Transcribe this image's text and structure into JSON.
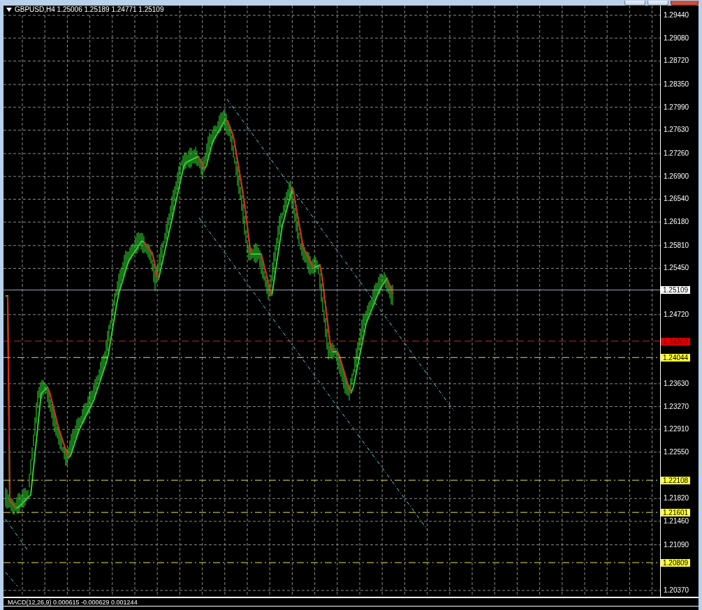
{
  "chart": {
    "header": "GBPUSD,H4  1.25006 1.25189 1.24771 1.25109",
    "axis_labels": [
      "1.29440",
      "1.29080",
      "1.28720",
      "1.28350",
      "1.27990",
      "1.27630",
      "1.27260",
      "1.26900",
      "1.26540",
      "1.26180",
      "1.25810",
      "1.25450",
      "1.24720",
      "1.23630",
      "1.23270",
      "1.22910",
      "1.22550",
      "1.21820",
      "1.21460",
      "1.21090",
      "1.20370"
    ],
    "levels": [
      {
        "label": "1.25109",
        "kind": "bid"
      },
      {
        "label": "1.24302",
        "kind": "stop"
      },
      {
        "label": "1.24044",
        "kind": "level"
      },
      {
        "label": "1.22108",
        "kind": "level"
      },
      {
        "label": "1.21601",
        "kind": "level"
      },
      {
        "label": "1.20809",
        "kind": "level"
      }
    ]
  },
  "indicator": {
    "label": "MACD(12,26,9) 0.000615 -0.000629 0.001244"
  }
}
